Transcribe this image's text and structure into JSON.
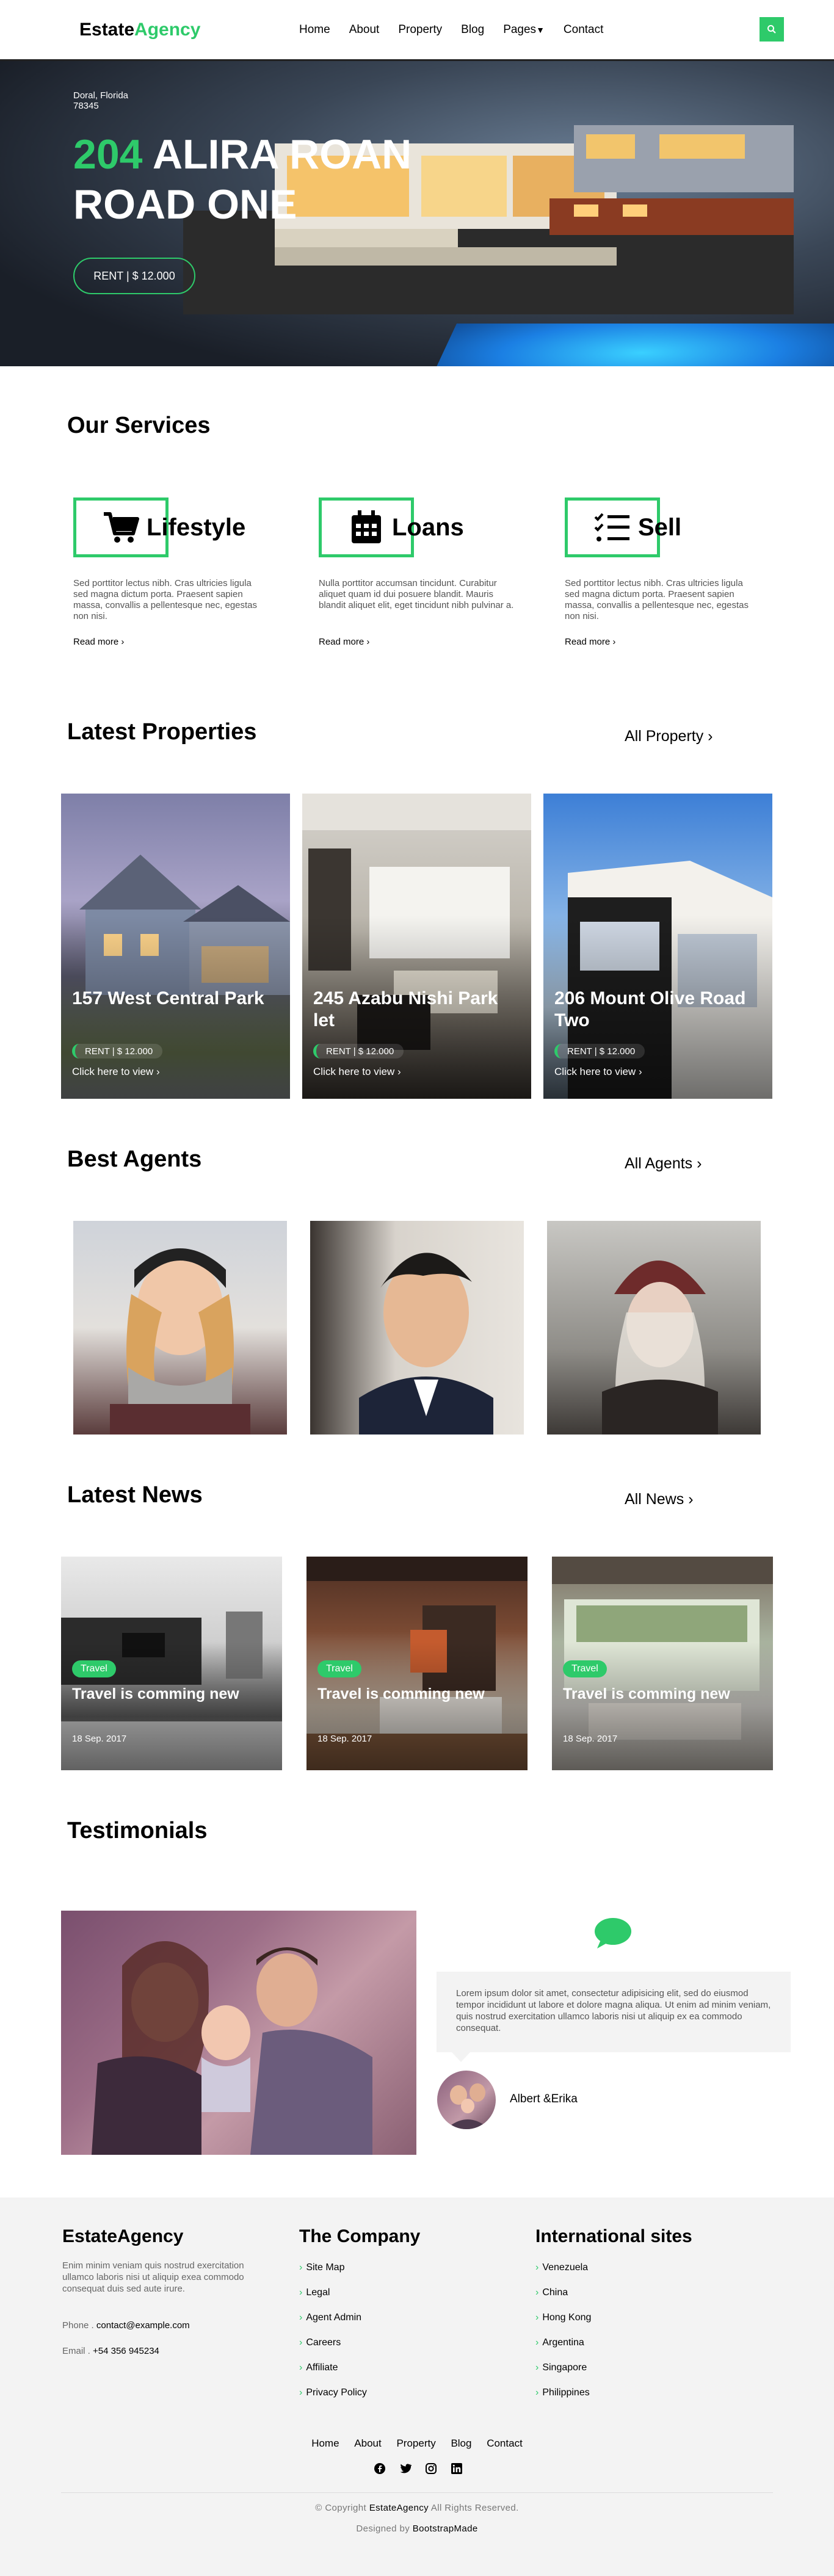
{
  "brand": {
    "name_part1": "Estate",
    "name_part2": "Agency"
  },
  "nav": [
    "Home",
    "About",
    "Property",
    "Blog",
    "Pages",
    "Contact"
  ],
  "hero": {
    "location_line1": "Doral, Florida",
    "location_line2": "78345",
    "title_number": "204",
    "title_rest": " ALIRA ROAN ROAD ONE",
    "badge": "RENT | $ 12.000"
  },
  "services": {
    "title": "Our Services",
    "items": [
      {
        "name": "Lifestyle",
        "icon": "cart-icon",
        "desc": "Sed porttitor lectus nibh. Cras ultricies ligula sed magna dictum porta. Praesent sapien massa, convallis a pellentesque nec, egestas non nisi.",
        "more": "Read more"
      },
      {
        "name": "Loans",
        "icon": "calendar-icon",
        "desc": "Nulla porttitor accumsan tincidunt. Curabitur aliquet quam id dui posuere blandit. Mauris blandit aliquet elit, eget tincidunt nibh pulvinar a.",
        "more": "Read more"
      },
      {
        "name": "Sell",
        "icon": "checklist-icon",
        "desc": "Sed porttitor lectus nibh. Cras ultricies ligula sed magna dictum porta. Praesent sapien massa, convallis a pellentesque nec, egestas non nisi.",
        "more": "Read more"
      }
    ]
  },
  "properties": {
    "title": "Latest Properties",
    "link": "All Property",
    "items": [
      {
        "title": "157 West Central Park",
        "price": "RENT | $ 12.000",
        "view": "Click here to view"
      },
      {
        "title": "245 Azabu Nishi Park let",
        "price": "RENT | $ 12.000",
        "view": "Click here to view"
      },
      {
        "title": "206 Mount Olive Road Two",
        "price": "RENT | $ 12.000",
        "view": "Click here to view"
      }
    ]
  },
  "agents": {
    "title": "Best Agents",
    "link": "All Agents"
  },
  "news": {
    "title": "Latest News",
    "link": "All News",
    "items": [
      {
        "tag": "Travel",
        "title": "Travel is comming new",
        "date": "18 Sep. 2017"
      },
      {
        "tag": "Travel",
        "title": "Travel is comming new",
        "date": "18 Sep. 2017"
      },
      {
        "tag": "Travel",
        "title": "Travel is comming new",
        "date": "18 Sep. 2017"
      }
    ]
  },
  "testimonials": {
    "title": "Testimonials",
    "quote": "Lorem ipsum dolor sit amet, consectetur adipisicing elit, sed do eiusmod tempor incididunt ut labore et dolore magna aliqua. Ut enim ad minim veniam, quis nostrud exercitation ullamco laboris nisi ut aliquip ex ea commodo consequat.",
    "author": "Albert &Erika"
  },
  "footer": {
    "brand": "EstateAgency",
    "about": "Enim minim veniam quis nostrud exercitation ullamco laboris nisi ut aliquip exea commodo consequat duis sed aute irure.",
    "phone_label": "Phone .",
    "phone": "contact@example.com",
    "email_label": "Email .",
    "email": "+54 356 945234",
    "company_title": "The Company",
    "company_links": [
      "Site Map",
      "Legal",
      "Agent Admin",
      "Careers",
      "Affiliate",
      "Privacy Policy"
    ],
    "intl_title": "International sites",
    "intl_links": [
      "Venezuela",
      "China",
      "Hong Kong",
      "Argentina",
      "Singapore",
      "Philippines"
    ],
    "nav": [
      "Home",
      "About",
      "Property",
      "Blog",
      "Contact"
    ],
    "copyright_pre": "© Copyright",
    "copyright_brand": "EstateAgency",
    "copyright_post": "All Rights Reserved.",
    "designed_pre": "Designed by",
    "designed_by": "BootstrapMade"
  },
  "colors": {
    "accent": "#2eca6a",
    "footer_bg": "#f3f3f3"
  }
}
